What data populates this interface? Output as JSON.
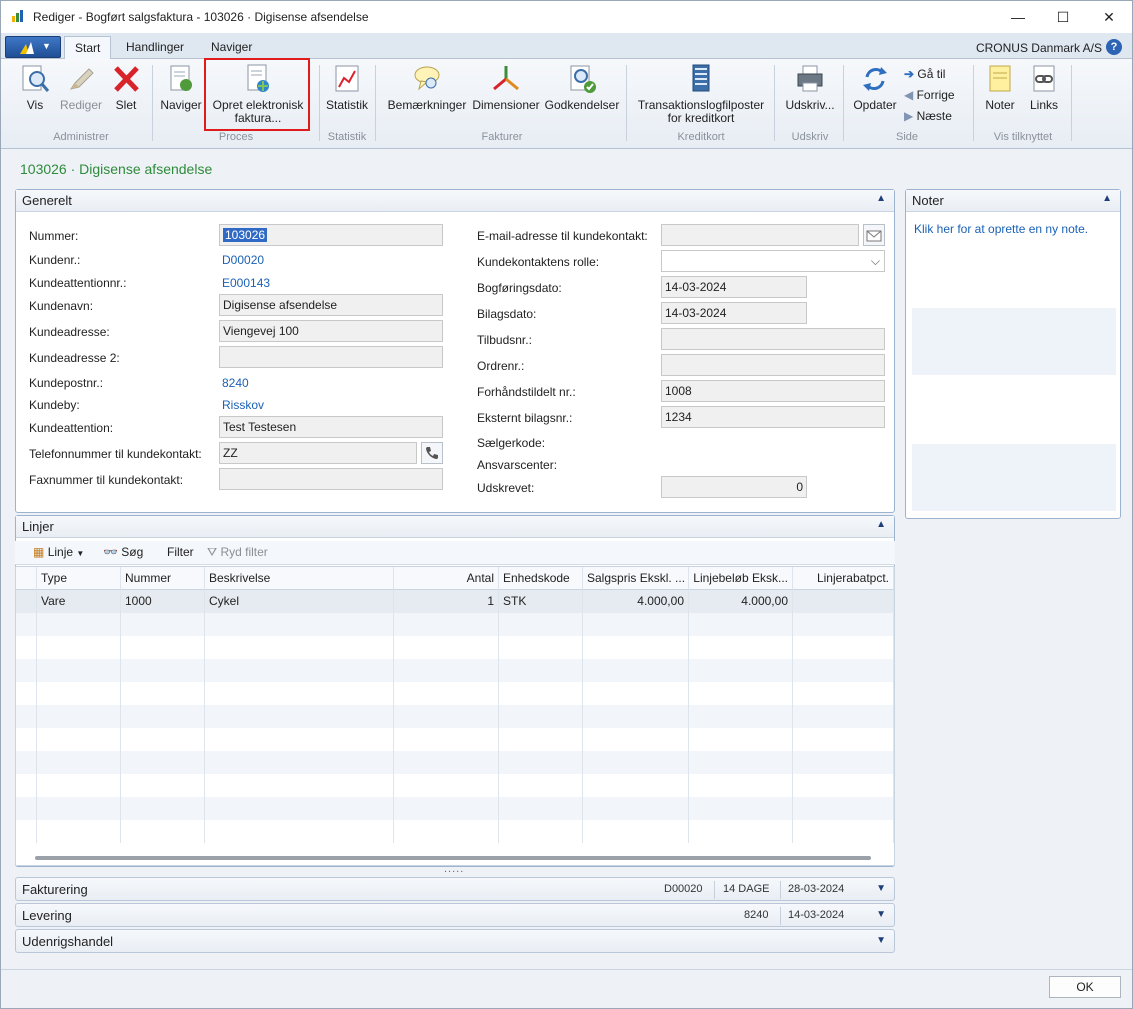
{
  "window": {
    "title": "Rediger - Bogført salgsfaktura - 103026 · Digisense afsendelse",
    "minimize": "—",
    "maximize": "☐",
    "close": "✕"
  },
  "ribbon_tabs": [
    "Start",
    "Handlinger",
    "Naviger"
  ],
  "company": "CRONUS Danmark A/S",
  "help": "?",
  "ribbon": {
    "buttons": {
      "vis": "Vis",
      "rediger": "Rediger",
      "slet": "Slet",
      "naviger": "Naviger",
      "opret1": "Opret elektronisk",
      "opret2": "faktura...",
      "statistik": "Statistik",
      "bemaerkninger": "Bemærkninger",
      "dimensioner": "Dimensioner",
      "godkendelser": "Godkendelser",
      "translog1": "Transaktionslogfilposter",
      "translog2": "for kreditkort",
      "udskriv": "Udskriv...",
      "opdater": "Opdater",
      "gaa_til": "Gå til",
      "forrige": "Forrige",
      "naeste": "Næste",
      "noter": "Noter",
      "links": "Links"
    },
    "groups": {
      "administrer": "Administrer",
      "proces": "Proces",
      "statistik": "Statistik",
      "fakturer": "Fakturer",
      "kreditkort": "Kreditkort",
      "udskriv": "Udskriv",
      "side": "Side",
      "vis_tilknyttet": "Vis tilknyttet"
    }
  },
  "page_title": "103026 · Digisense afsendelse",
  "generelt": {
    "title": "Generelt",
    "labels": {
      "nummer": "Nummer:",
      "kundenr": "Kundenr.:",
      "kundeattentionnr": "Kundeattentionnr.:",
      "kundenavn": "Kundenavn:",
      "kundeadresse": "Kundeadresse:",
      "kundeadresse2": "Kundeadresse 2:",
      "kundepostnr": "Kundepostnr.:",
      "kundeby": "Kundeby:",
      "kundeattention": "Kundeattention:",
      "telefon": "Telefonnummer til kundekontakt:",
      "fax": "Faxnummer til kundekontakt:",
      "email": "E-mail-adresse til kundekontakt:",
      "rolle": "Kundekontaktens rolle:",
      "bogforingsdato": "Bogføringsdato:",
      "bilagsdato": "Bilagsdato:",
      "tilbudsnr": "Tilbudsnr.:",
      "ordrenr": "Ordrenr.:",
      "forhaandstildelt": "Forhåndstildelt nr.:",
      "eksternt": "Eksternt bilagsnr.:",
      "saelgerkode": "Sælgerkode:",
      "ansvarscenter": "Ansvarscenter:",
      "udskrevet": "Udskrevet:"
    },
    "values": {
      "nummer": "103026",
      "kundenr": "D00020",
      "kundeattentionnr": "E000143",
      "kundenavn": "Digisense afsendelse",
      "kundeadresse": "Viengevej 100",
      "kundeadresse2": "",
      "kundepostnr": "8240",
      "kundeby": "Risskov",
      "kundeattention": "Test Testesen",
      "telefon": "ZZ",
      "fax": "",
      "email": "",
      "rolle": "",
      "bogforingsdato": "14-03-2024",
      "bilagsdato": "14-03-2024",
      "tilbudsnr": "",
      "ordrenr": "",
      "forhaandstildelt": "1008",
      "eksternt": "1234",
      "udskrevet": "0"
    }
  },
  "noter": {
    "title": "Noter",
    "link": "Klik her for at oprette en ny note."
  },
  "linjer": {
    "title": "Linjer",
    "toolbar": {
      "linje": "Linje",
      "soeg": "Søg",
      "filter": "Filter",
      "ryd_filter": "Ryd filter"
    },
    "columns": [
      "Type",
      "Nummer",
      "Beskrivelse",
      "Antal",
      "Enhedskode",
      "Salgspris Ekskl. ...",
      "Linjebeløb Eksk...",
      "Linjerabatpct."
    ],
    "rows": [
      [
        "Vare",
        "1000",
        "Cykel",
        "1",
        "STK",
        "4.000,00",
        "4.000,00",
        ""
      ]
    ],
    "splitter": "....."
  },
  "collapsed_tabs": [
    {
      "title": "Fakturering",
      "values": [
        "D00020",
        "14 DAGE",
        "28-03-2024"
      ]
    },
    {
      "title": "Levering",
      "values": [
        "8240",
        "14-03-2024"
      ]
    },
    {
      "title": "Udenrigshandel",
      "values": []
    }
  ],
  "ok_button": "OK",
  "colors": {
    "page_title": "#2e8b3a",
    "link": "#1a61b5",
    "highlight": "#e01b1b"
  }
}
